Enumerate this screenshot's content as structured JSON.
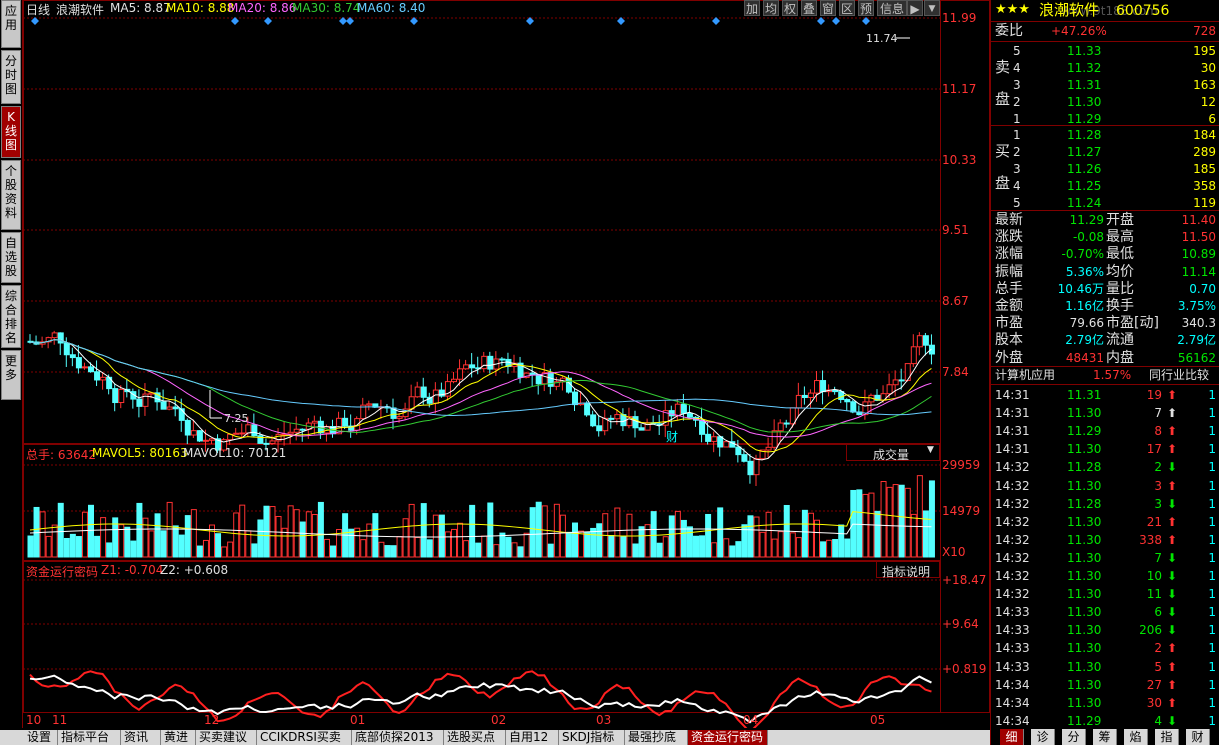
{
  "left_tabs": [
    "应用",
    "分时图",
    "K线图",
    "个股资料",
    "自选股",
    "综合排名",
    "更多"
  ],
  "main": {
    "period": "日线",
    "stock_name": "浪潮软件",
    "ma5": "MA5: 8.87",
    "ma10": "MA10: 8.88",
    "ma20": "MA20: 8.86",
    "ma30": "MA30: 8.74",
    "ma60": "MA60: 8.40",
    "price_ticks": [
      "11.99",
      "11.17",
      "10.33",
      "9.51",
      "8.67",
      "7.84"
    ],
    "high_mark": "11.74",
    "low_mark": "7.25",
    "fin_mark": "财",
    "toolbar": [
      "加",
      "均",
      "权",
      "叠",
      "窗",
      "区",
      "预",
      "信息"
    ]
  },
  "volume": {
    "total": "总手: 63642",
    "mavol5": "MAVOL5: 80163",
    "mavol10": "MAVOL10: 70121",
    "selector": "成交量",
    "ticks": [
      "29959",
      "14979"
    ],
    "unit": "X10"
  },
  "indicator": {
    "name": "资金运行密码",
    "z1": "Z1: -0.704",
    "z2": "Z2: +0.608",
    "help": "指标说明",
    "ticks": [
      "+18.47",
      "+9.64",
      "+0.819"
    ]
  },
  "x_axis": [
    "10",
    "11",
    "12",
    "01",
    "02",
    "03",
    "04",
    "05"
  ],
  "bottom_tabs": [
    "设置",
    "指标平台",
    "资讯",
    "黄进",
    "买卖建议",
    "CCIKDRSI买卖",
    "底部侦探2013",
    "选股买点",
    "自用12",
    "SKDJ指标",
    "最强抄底",
    "资金运行密码"
  ],
  "right": {
    "title": "浪潮软件",
    "code": "600756",
    "watermark": "www.9t188.com",
    "weibi_label": "委比",
    "weibi_value": "+47.26%",
    "weibi_diff": "728",
    "sell_label": [
      "卖",
      "盘"
    ],
    "buy_label": [
      "买",
      "盘"
    ],
    "sell": [
      {
        "lvl": "5",
        "price": "11.33",
        "vol": "195"
      },
      {
        "lvl": "4",
        "price": "11.32",
        "vol": "30"
      },
      {
        "lvl": "3",
        "price": "11.31",
        "vol": "163"
      },
      {
        "lvl": "2",
        "price": "11.30",
        "vol": "12"
      },
      {
        "lvl": "1",
        "price": "11.29",
        "vol": "6"
      }
    ],
    "buy": [
      {
        "lvl": "1",
        "price": "11.28",
        "vol": "184"
      },
      {
        "lvl": "2",
        "price": "11.27",
        "vol": "289"
      },
      {
        "lvl": "3",
        "price": "11.26",
        "vol": "185"
      },
      {
        "lvl": "4",
        "price": "11.25",
        "vol": "358"
      },
      {
        "lvl": "5",
        "price": "11.24",
        "vol": "119"
      }
    ],
    "quote": [
      {
        "l1": "最新",
        "v1": "11.29",
        "c1": "green",
        "l2": "开盘",
        "v2": "11.40",
        "c2": "red"
      },
      {
        "l1": "涨跌",
        "v1": "-0.08",
        "c1": "green",
        "l2": "最高",
        "v2": "11.50",
        "c2": "red"
      },
      {
        "l1": "涨幅",
        "v1": "-0.70%",
        "c1": "green",
        "l2": "最低",
        "v2": "10.89",
        "c2": "green"
      },
      {
        "l1": "振幅",
        "v1": "5.36%",
        "c1": "cyan",
        "l2": "均价",
        "v2": "11.14",
        "c2": "green"
      },
      {
        "l1": "总手",
        "v1": "10.46万",
        "c1": "cyan",
        "l2": "量比",
        "v2": "0.70",
        "c2": "cyan"
      },
      {
        "l1": "金额",
        "v1": "1.16亿",
        "c1": "cyan",
        "l2": "换手",
        "v2": "3.75%",
        "c2": "cyan"
      },
      {
        "l1": "市盈",
        "v1": "79.66",
        "c1": "white",
        "l2": "市盈[动]",
        "v2": "340.3",
        "c2": "white"
      },
      {
        "l1": "股本",
        "v1": "2.79亿",
        "c1": "cyan",
        "l2": "流通",
        "v2": "2.79亿",
        "c2": "cyan"
      },
      {
        "l1": "外盘",
        "v1": "48431",
        "c1": "red",
        "l2": "内盘",
        "v2": "56162",
        "c2": "green"
      }
    ],
    "sector": "计算机应用",
    "sector_pct": "1.57%",
    "compare": "同行业比较",
    "ticks": [
      {
        "t": "14:31",
        "p": "11.31",
        "v": "19",
        "dir": "up",
        "n": "1"
      },
      {
        "t": "14:31",
        "p": "11.30",
        "v": "7",
        "dir": "white",
        "n": "1"
      },
      {
        "t": "14:31",
        "p": "11.29",
        "v": "8",
        "dir": "up",
        "n": "1"
      },
      {
        "t": "14:31",
        "p": "11.30",
        "v": "17",
        "dir": "up",
        "n": "1"
      },
      {
        "t": "14:32",
        "p": "11.28",
        "v": "2",
        "dir": "down",
        "n": "1"
      },
      {
        "t": "14:32",
        "p": "11.30",
        "v": "3",
        "dir": "up",
        "n": "1"
      },
      {
        "t": "14:32",
        "p": "11.28",
        "v": "3",
        "dir": "down",
        "n": "1"
      },
      {
        "t": "14:32",
        "p": "11.30",
        "v": "21",
        "dir": "up",
        "n": "1"
      },
      {
        "t": "14:32",
        "p": "11.30",
        "v": "338",
        "dir": "up",
        "n": "1"
      },
      {
        "t": "14:32",
        "p": "11.30",
        "v": "7",
        "dir": "down",
        "n": "1"
      },
      {
        "t": "14:32",
        "p": "11.30",
        "v": "10",
        "dir": "down",
        "n": "1"
      },
      {
        "t": "14:32",
        "p": "11.30",
        "v": "11",
        "dir": "down",
        "n": "1"
      },
      {
        "t": "14:33",
        "p": "11.30",
        "v": "6",
        "dir": "down",
        "n": "1"
      },
      {
        "t": "14:33",
        "p": "11.30",
        "v": "206",
        "dir": "down",
        "n": "1"
      },
      {
        "t": "14:33",
        "p": "11.30",
        "v": "2",
        "dir": "up",
        "n": "1"
      },
      {
        "t": "14:33",
        "p": "11.30",
        "v": "5",
        "dir": "up",
        "n": "1"
      },
      {
        "t": "14:34",
        "p": "11.30",
        "v": "27",
        "dir": "up",
        "n": "1"
      },
      {
        "t": "14:34",
        "p": "11.30",
        "v": "30",
        "dir": "up",
        "n": "1"
      },
      {
        "t": "14:34",
        "p": "11.29",
        "v": "4",
        "dir": "down",
        "n": "1"
      }
    ],
    "bottom_tabs": [
      "细",
      "诊",
      "分",
      "筹",
      "焰",
      "指",
      "财"
    ]
  }
}
